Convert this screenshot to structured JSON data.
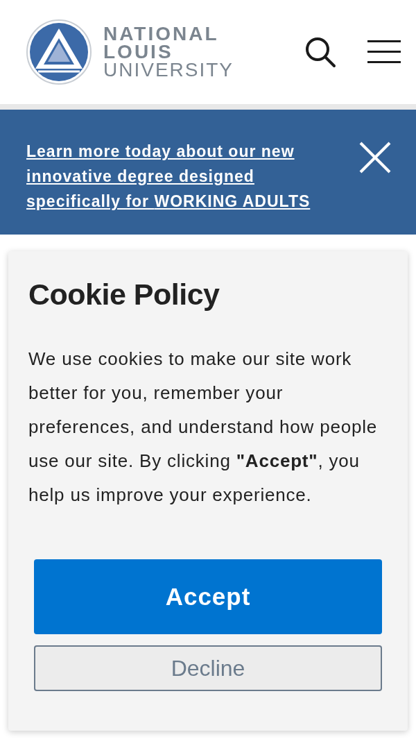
{
  "header": {
    "logo_lines": [
      "NATIONAL",
      "LOUIS",
      "UNIVERSITY"
    ]
  },
  "banner": {
    "text": "Learn more today about our new innovative degree designed specifically for **WORKING ADULTS**"
  },
  "cookie_dialog": {
    "title": "Cookie Policy",
    "body": "We use cookies to make our site work better for you, remember your preferences, and understand how people use our site. By clicking **\"Accept\"**, you help us improve your experience.",
    "buttons": [
      {
        "label": "Accept",
        "kind": "primary"
      },
      {
        "label": "Decline",
        "kind": "secondary"
      }
    ]
  }
}
